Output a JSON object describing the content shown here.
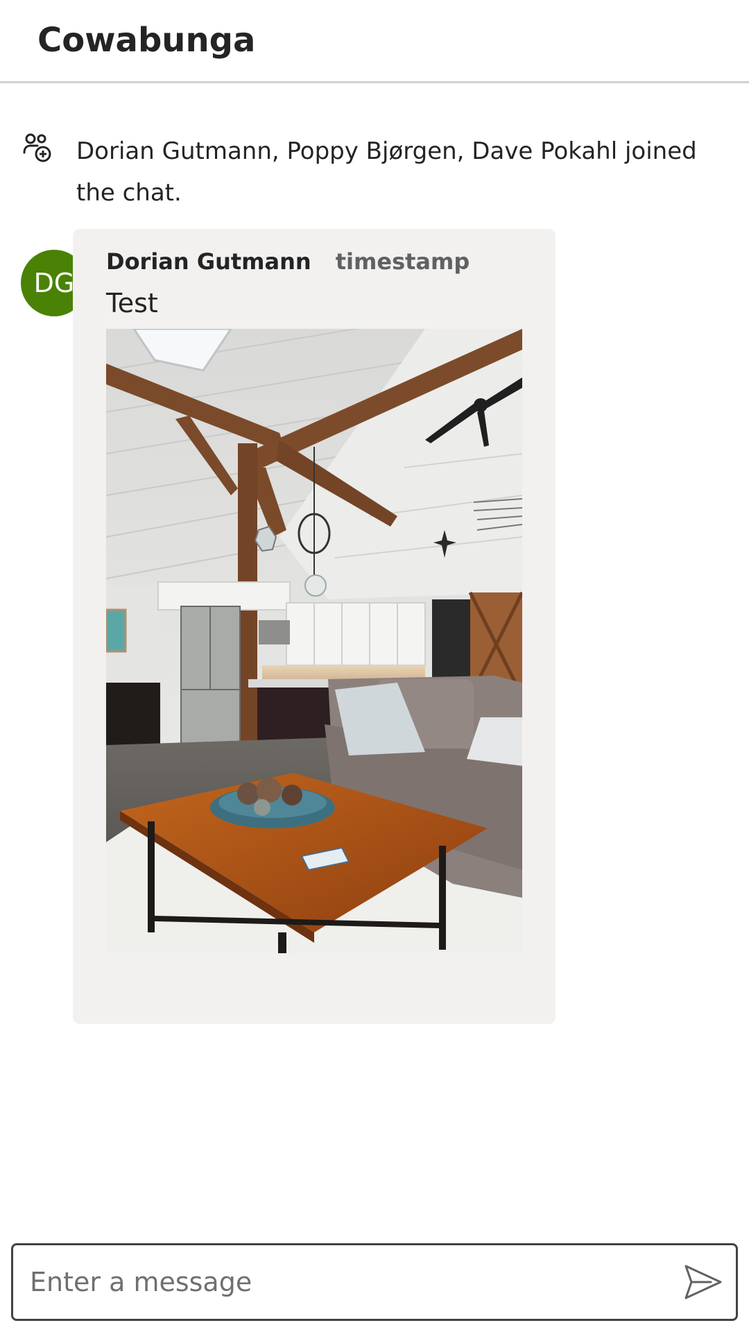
{
  "header": {
    "title": "Cowabunga"
  },
  "system_message": {
    "icon": "person-add-icon",
    "text": "Dorian Gutmann, Poppy Bjørgen, Dave Pokahl joined the chat."
  },
  "message": {
    "avatar_initials": "DG",
    "avatar_color": "#498205",
    "author": "Dorian Gutmann",
    "timestamp": "timestamp",
    "text": "Test",
    "attachment": "living-room-photo"
  },
  "composer": {
    "placeholder": "Enter a message",
    "value": "",
    "send_icon": "send-icon"
  },
  "colors": {
    "bubble_bg": "#f2f1f0",
    "divider": "#d1d1d1",
    "text": "#242424",
    "secondary_text": "#616161"
  }
}
